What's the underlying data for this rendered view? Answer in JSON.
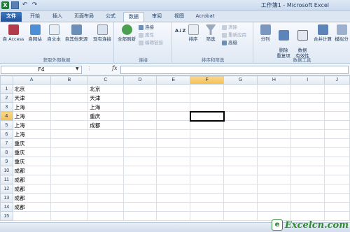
{
  "window": {
    "title": "工作簿1 - Microsoft Excel"
  },
  "tabs": [
    "文件",
    "开始",
    "插入",
    "页面布局",
    "公式",
    "数据",
    "审阅",
    "视图",
    "Acrobat"
  ],
  "ribbon": {
    "get_external": {
      "buttons": [
        "自 Access",
        "自网站",
        "自文本",
        "自其他来源",
        "现有连接"
      ],
      "label": "获取外部数据"
    },
    "connections": {
      "refresh_all": "全部刷新",
      "connections": "连接",
      "properties": "属性",
      "edit_links": "编辑链接",
      "label": "连接"
    },
    "sort_filter": {
      "sort_az": "A↓Z",
      "sort": "排序",
      "filter": "筛选",
      "clear": "清除",
      "reapply": "重新应用",
      "advanced": "高级",
      "label": "排序和筛选"
    },
    "data_tools": {
      "text_to_columns": "分列",
      "remove_duplicates": "删除\n重复项",
      "data_validation": "数据\n有效性",
      "consolidate": "合并计算",
      "what_if": "模拟分",
      "label": "数据工具"
    }
  },
  "formula_bar": {
    "name_box": "F4",
    "fx": "fx",
    "formula": ""
  },
  "columns": [
    "A",
    "B",
    "C",
    "D",
    "E",
    "F",
    "G",
    "H",
    "I",
    "J"
  ],
  "selected_column": "F",
  "selected_row": "4",
  "rows": [
    {
      "n": "1",
      "A": "北京",
      "C": "北京"
    },
    {
      "n": "2",
      "A": "天津",
      "C": "天津"
    },
    {
      "n": "3",
      "A": "上海",
      "C": "上海"
    },
    {
      "n": "4",
      "A": "上海",
      "C": "重庆"
    },
    {
      "n": "5",
      "A": "上海",
      "C": "成都"
    },
    {
      "n": "6",
      "A": "上海",
      "C": ""
    },
    {
      "n": "7",
      "A": "重庆",
      "C": ""
    },
    {
      "n": "8",
      "A": "重庆",
      "C": ""
    },
    {
      "n": "9",
      "A": "重庆",
      "C": ""
    },
    {
      "n": "10",
      "A": "成都",
      "C": ""
    },
    {
      "n": "11",
      "A": "成都",
      "C": ""
    },
    {
      "n": "12",
      "A": "成都",
      "C": ""
    },
    {
      "n": "13",
      "A": "成都",
      "C": ""
    },
    {
      "n": "14",
      "A": "成都",
      "C": ""
    },
    {
      "n": "15",
      "A": "",
      "C": ""
    }
  ],
  "watermark": {
    "logo": "e",
    "text": "Excelcn.com"
  }
}
